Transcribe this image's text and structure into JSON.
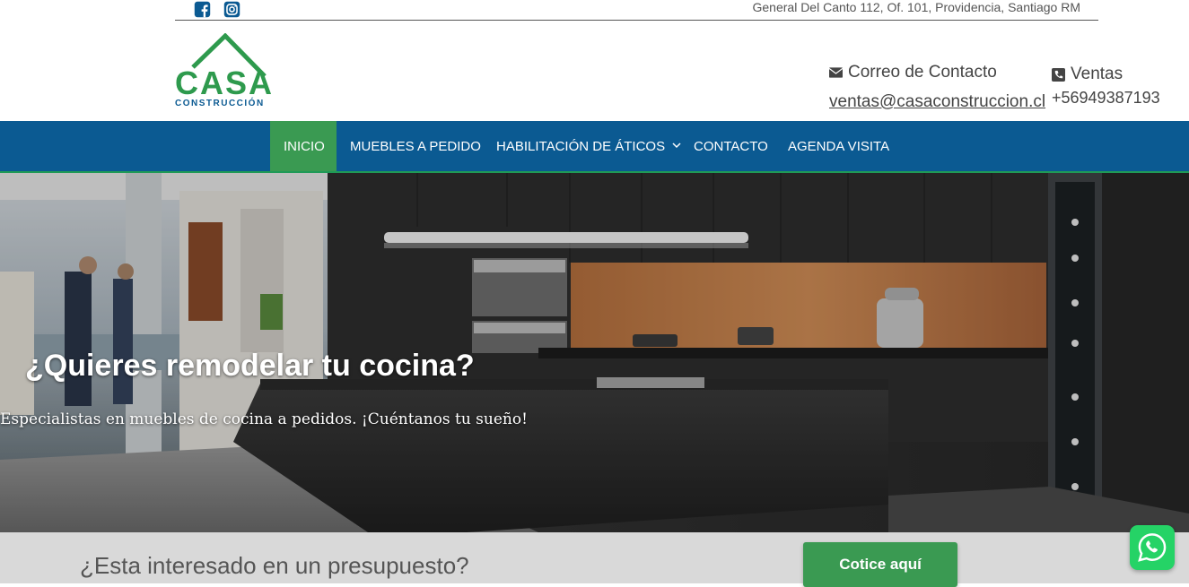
{
  "topbar": {
    "facebook_icon": "facebook-icon",
    "instagram_icon": "instagram-icon",
    "address": "General Del Canto 112, Of. 101, Providencia, Santiago RM"
  },
  "header": {
    "logo_text": "CASA",
    "logo_subtext": "CONSTRUCCIÓN",
    "contact_label": "Correo de Contacto",
    "contact_email": "ventas@casaconstruccion.cl",
    "sales_label": "Ventas",
    "sales_phone": "+56949387193"
  },
  "nav": {
    "items": [
      {
        "label": "INICIO",
        "active": true
      },
      {
        "label": "MUEBLES A PEDIDO"
      },
      {
        "label": "HABILITACIÓN DE ÁTICOS",
        "has_dropdown": true
      },
      {
        "label": "CONTACTO"
      },
      {
        "label": "AGENDA VISITA"
      }
    ]
  },
  "hero": {
    "title": "¿Quieres remodelar tu cocina?",
    "subtitle": "Especialistas en muebles de cocina a pedidos. ¡Cuéntanos tu sueño!"
  },
  "cta": {
    "text": "¿Esta interesado en un presupuesto?",
    "button": "Cotice aquí"
  },
  "colors": {
    "brand_green": "#2e9a4d",
    "nav_blue": "#0b5a92",
    "active_green": "#3a9a52",
    "whatsapp": "#25d366"
  }
}
